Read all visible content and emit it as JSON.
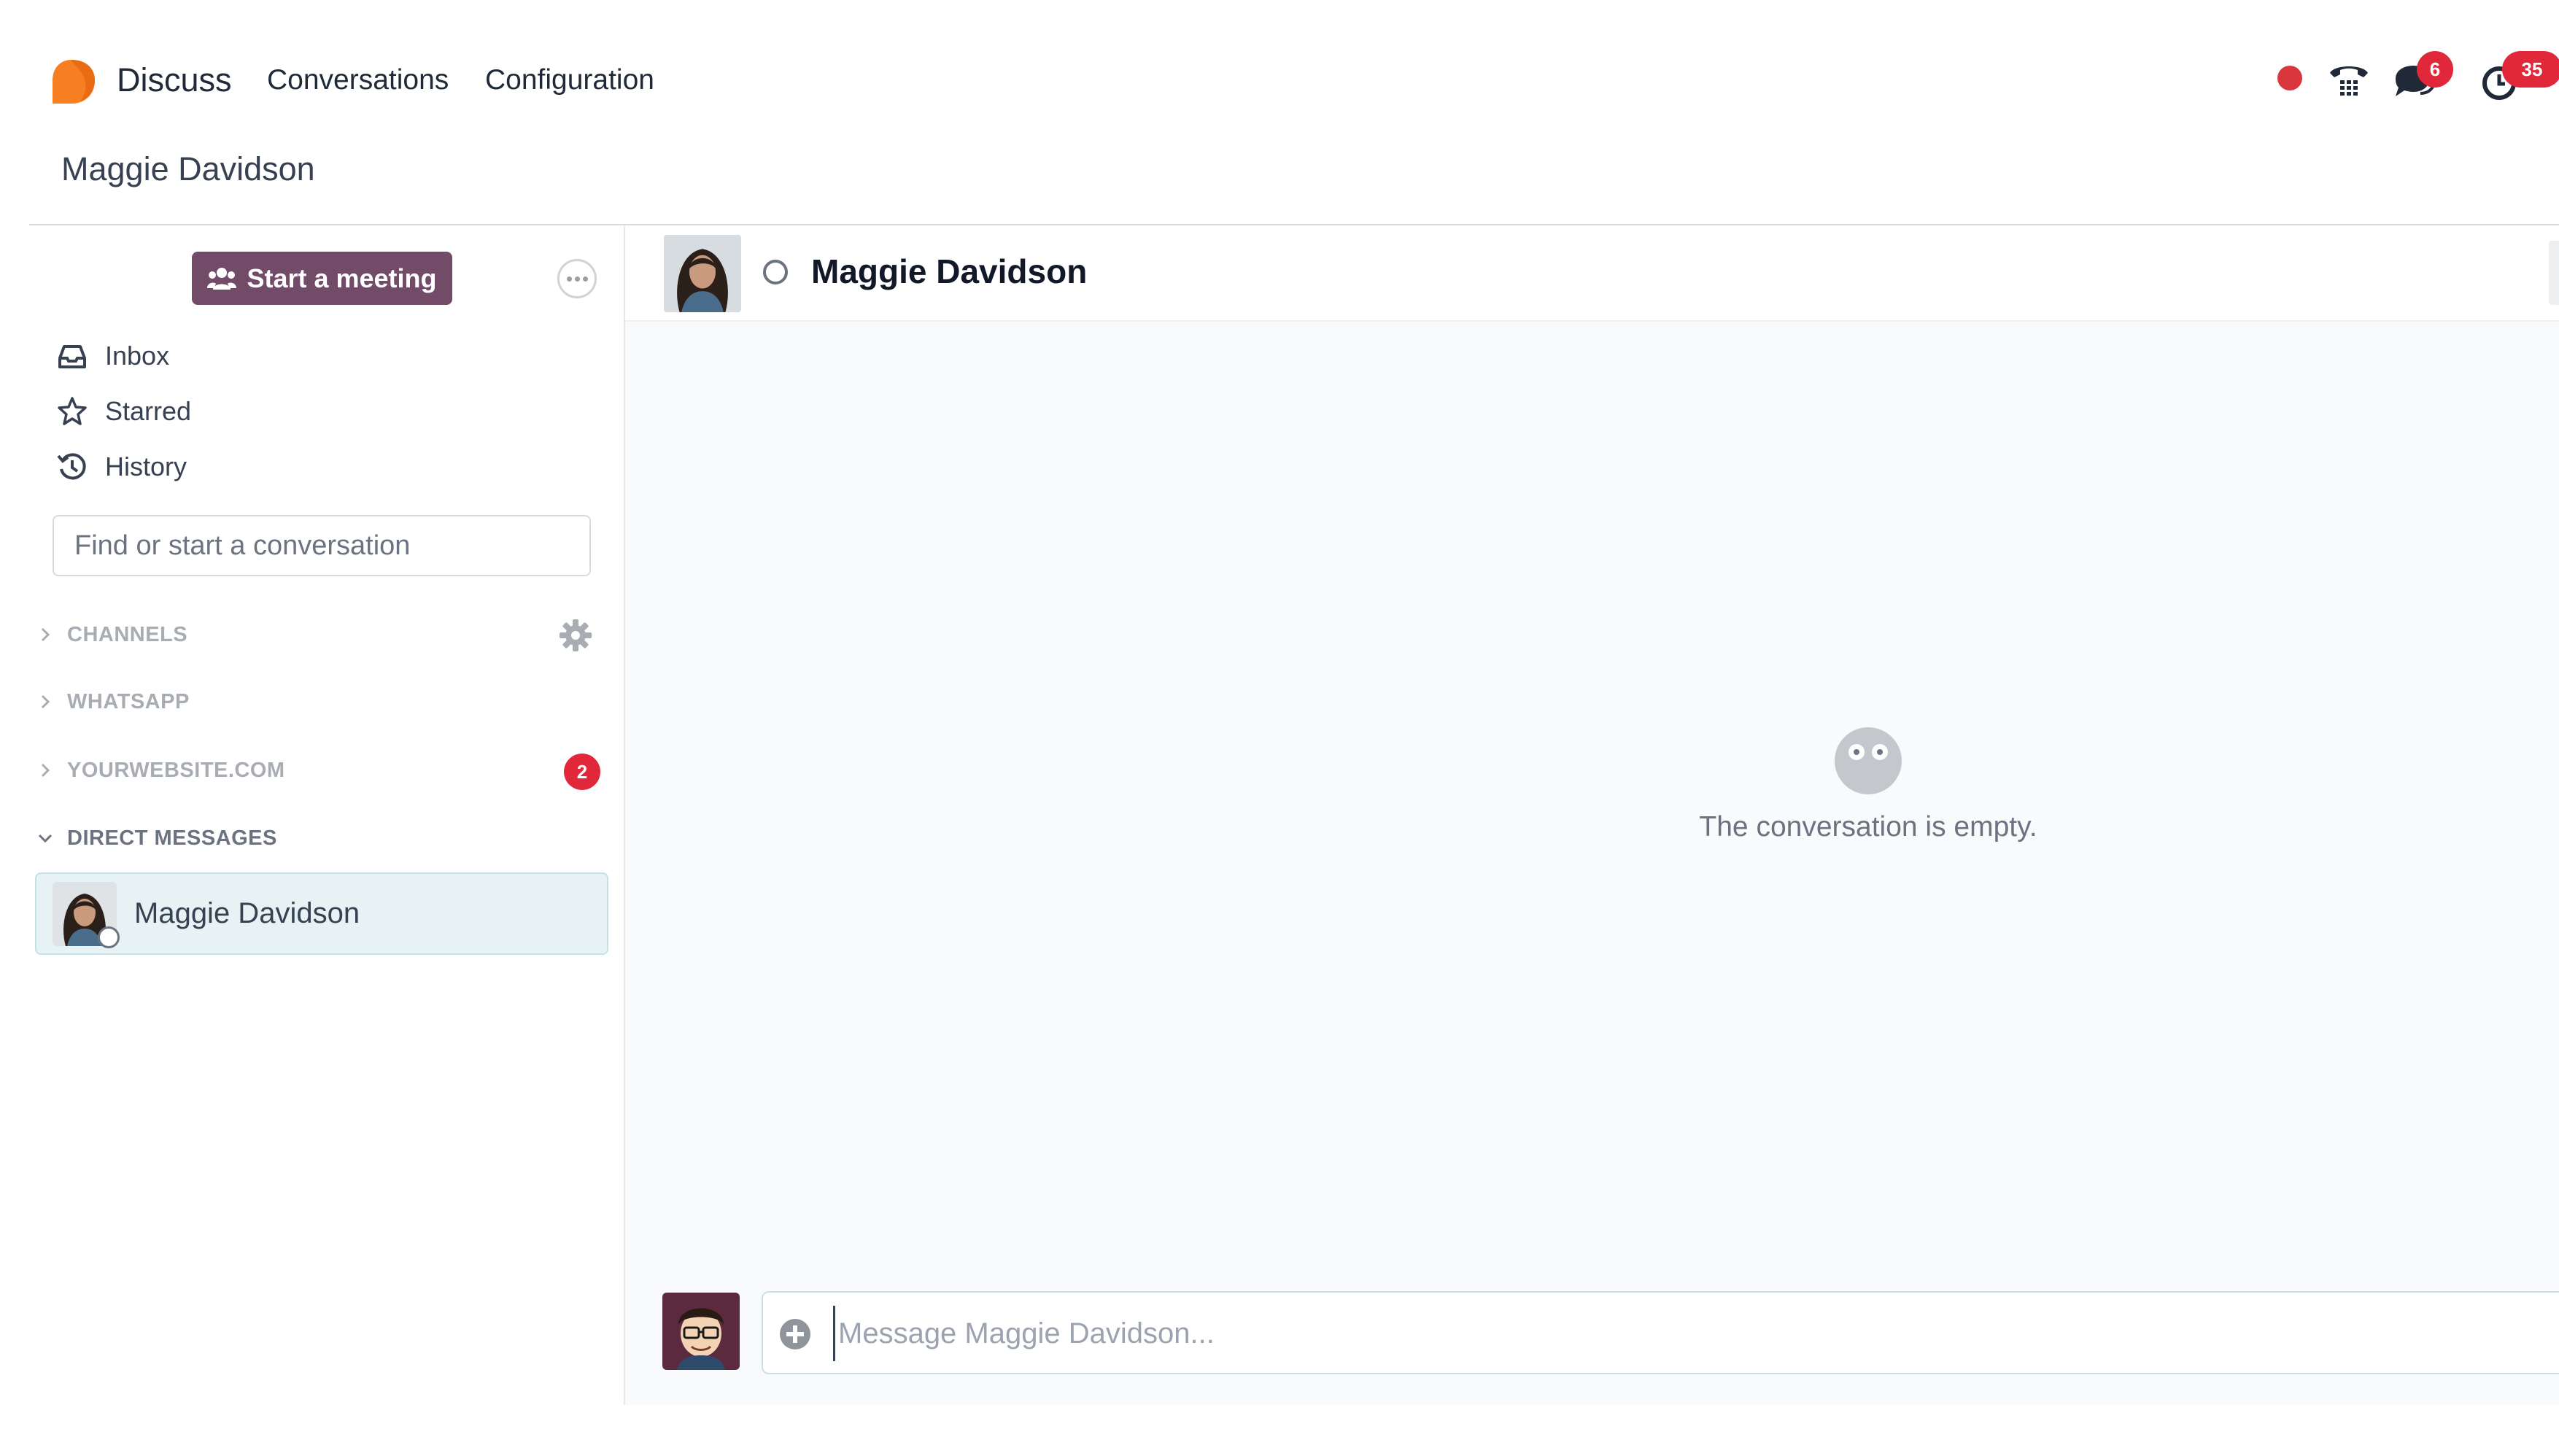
{
  "navbar": {
    "app_name": "Discuss",
    "menus": [
      {
        "label": "Conversations"
      },
      {
        "label": "Configuration"
      }
    ],
    "systray": {
      "recording_color": "#d9363e",
      "messages_badge": "6",
      "activities_badge": "35"
    }
  },
  "breadcrumb": "Maggie Davidson",
  "sidebar": {
    "start_meeting_label": "Start a meeting",
    "menu_items": [
      {
        "label": "Inbox",
        "icon": "inbox-icon"
      },
      {
        "label": "Starred",
        "icon": "star-icon"
      },
      {
        "label": "History",
        "icon": "history-icon"
      }
    ],
    "search_placeholder": "Find or start a conversation",
    "categories": [
      {
        "label": "CHANNELS",
        "expanded": false
      },
      {
        "label": "WHATSAPP",
        "expanded": false
      },
      {
        "label": "YOURWEBSITE.COM",
        "expanded": false,
        "badge": "2"
      },
      {
        "label": "DIRECT MESSAGES",
        "expanded": true
      }
    ],
    "direct_messages": [
      {
        "name": "Maggie Davidson",
        "status": "offline"
      }
    ]
  },
  "thread": {
    "title": "Maggie Davidson",
    "empty_text": "The conversation is empty.",
    "composer_placeholder": "Message Maggie Davidson..."
  },
  "colors": {
    "brand": "#714b67",
    "accent": "#e6f2f3",
    "badge": "#e0283a"
  }
}
